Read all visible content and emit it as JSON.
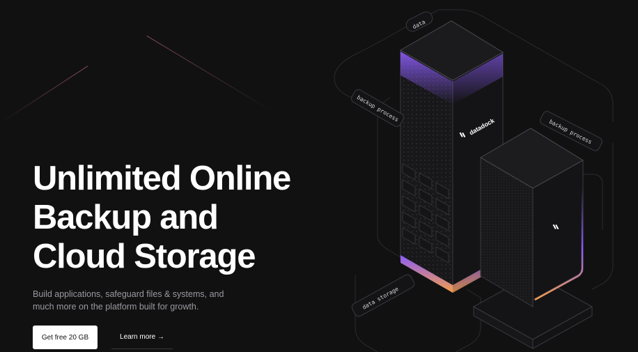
{
  "headline": {
    "line1": "Unlimited Online",
    "line2": "Backup and",
    "line3": "Cloud Storage"
  },
  "subtext": {
    "line1": "Build applications, safeguard files & systems, and",
    "line2": "much more on the platform built for growth."
  },
  "cta": {
    "primary_label": "Get free 20 GB",
    "secondary_label": "Learn more →"
  },
  "illustration": {
    "tag_data": "data",
    "tag_backup_left": "backup process",
    "tag_backup_right": "backup process",
    "tag_storage": "data storage",
    "logo_text": "datadock"
  },
  "colors": {
    "background": "#111112",
    "accent_purple": "#8b5cf6",
    "accent_orange": "#f59e4c",
    "text_muted": "#9a9aa0"
  }
}
